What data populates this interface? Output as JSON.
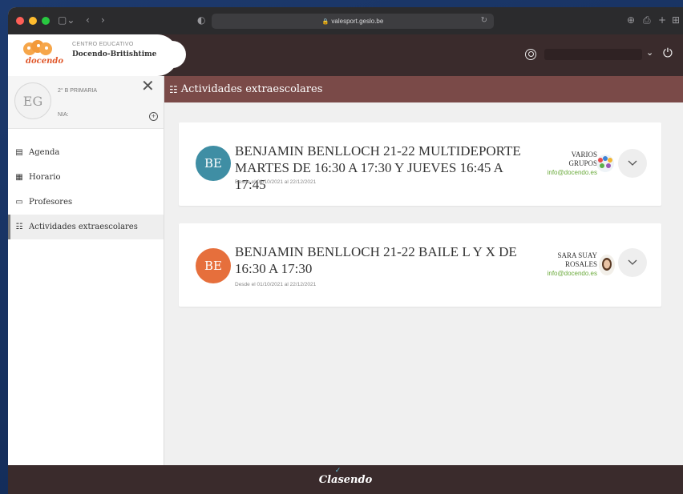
{
  "browser": {
    "url": "valesport.geslo.be",
    "colors": {
      "close": "#fe5f57",
      "minimize": "#febc2e",
      "zoom": "#28c840"
    }
  },
  "header": {
    "center_label": "CENTRO EDUCATIVO",
    "center_name": "Docendo-Britishtime",
    "logo_text": "docendo",
    "icons": [
      "user-circle-icon",
      "chevron-down-icon",
      "power-icon"
    ]
  },
  "profile": {
    "initials": "EG",
    "grade": "2° B PRIMARIA",
    "nia_label": "NIA:"
  },
  "sidebar": {
    "items": [
      {
        "label": "Agenda",
        "icon": "calendar-icon"
      },
      {
        "label": "Horario",
        "icon": "schedule-icon"
      },
      {
        "label": "Profesores",
        "icon": "teachers-icon"
      },
      {
        "label": "Actividades extraescolares",
        "icon": "activities-icon",
        "active": true
      }
    ]
  },
  "section": {
    "title": "Actividades extraescolares"
  },
  "activities": [
    {
      "initials": "BE",
      "avatar_color": "#3f8ea4",
      "title": "BENJAMIN BENLLOCH 21-22 MULTIDEPORTE MARTES DE 16:30 A 17:30 Y JUEVES 16:45 A 17:45",
      "dates": "Desde el 01/10/2021 al 22/12/2021",
      "teacher_line1": "VARIOS",
      "teacher_line2": "GRUPOS",
      "email": "info@docendo.es"
    },
    {
      "initials": "BE",
      "avatar_color": "#e66f3c",
      "title": "BENJAMIN BENLLOCH 21-22 BAILE L Y X DE 16:30 A 17:30",
      "dates": "Desde el 01/10/2021 al 22/12/2021",
      "teacher_line1": "SARA SUAY",
      "teacher_line2": "ROSALES",
      "email": "info@docendo.es"
    }
  ],
  "footer": {
    "brand": "Clasendo"
  }
}
